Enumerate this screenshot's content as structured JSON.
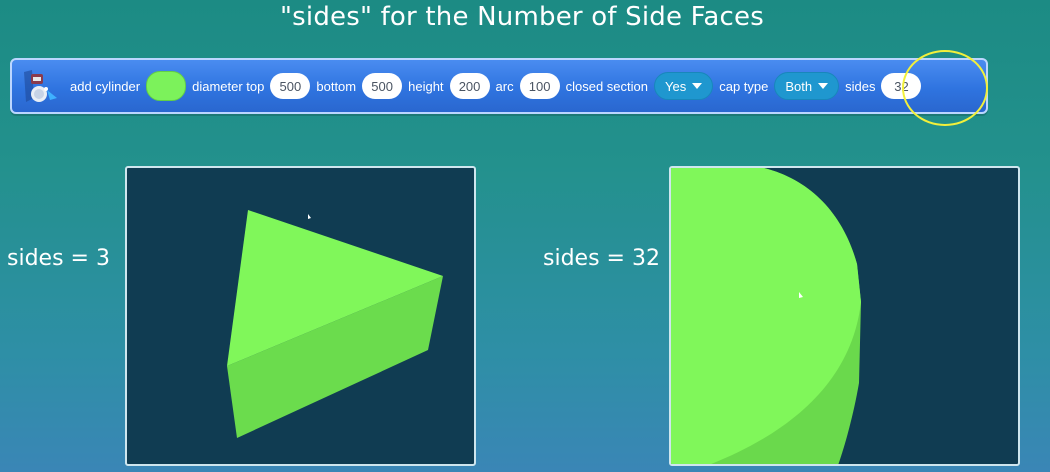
{
  "title": "\"sides\" for the Number of Side Faces",
  "block": {
    "icon": "robot-icon",
    "label_add": "add cylinder",
    "color": "#7cf25b",
    "label_diameter_top": "diameter top",
    "diameter_top": "500",
    "label_bottom": "bottom",
    "bottom": "500",
    "label_height": "height",
    "height": "200",
    "label_arc": "arc",
    "arc": "100",
    "label_closed_section": "closed section",
    "closed_section": "Yes",
    "label_cap_type": "cap type",
    "cap_type": "Both",
    "label_sides": "sides",
    "sides": "32"
  },
  "examples": [
    {
      "label": "sides = 3"
    },
    {
      "label": "sides = 32"
    }
  ],
  "colors": {
    "shape_top": "#80f75a",
    "shape_side": "#6ad94c",
    "viewport_bg": "#103c52",
    "highlight": "#f2f03a"
  }
}
